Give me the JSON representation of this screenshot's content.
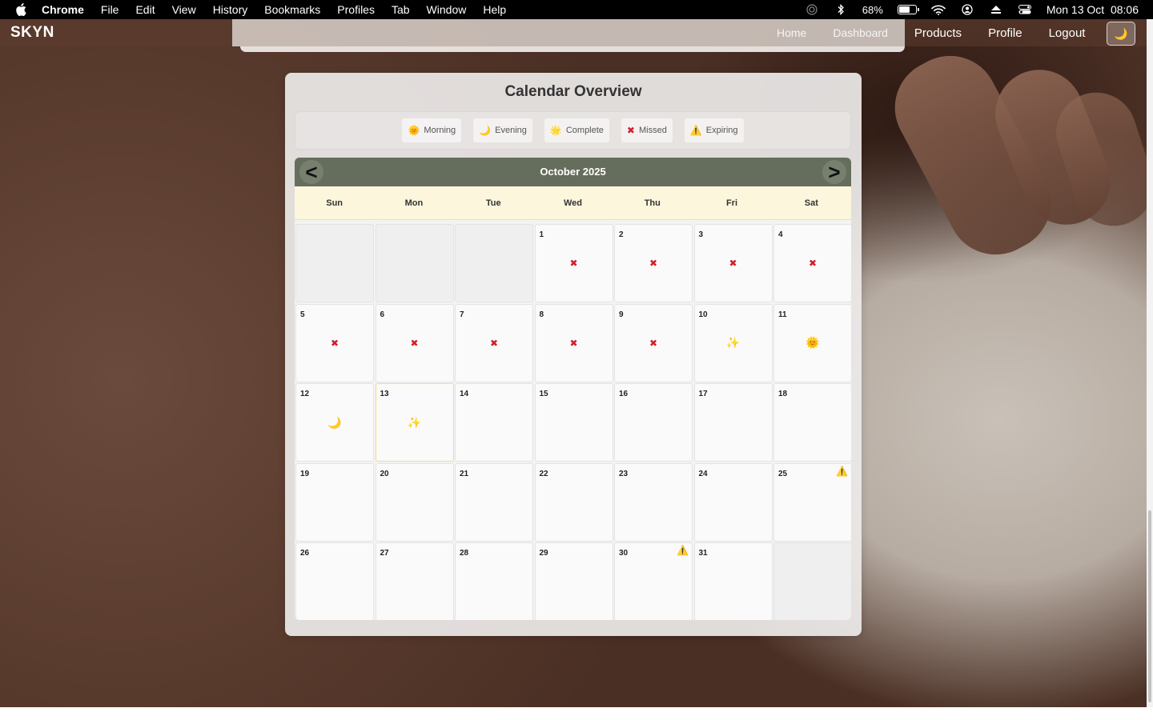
{
  "menubar": {
    "apple_icon": "apple-logo",
    "items": [
      "Chrome",
      "File",
      "Edit",
      "View",
      "History",
      "Bookmarks",
      "Profiles",
      "Tab",
      "Window",
      "Help"
    ],
    "battery": "68%",
    "datetime": "Mon 13 Oct  08:06"
  },
  "app": {
    "brand": "SKYN",
    "nav": [
      "Home",
      "Dashboard",
      "Products",
      "Profile",
      "Logout"
    ],
    "theme_toggle_icon": "🌙"
  },
  "calendar": {
    "title": "Calendar Overview",
    "legend": [
      {
        "icon": "🌞",
        "label": "Morning"
      },
      {
        "icon": "🌙",
        "label": "Evening"
      },
      {
        "icon": "🌟",
        "label": "Complete"
      },
      {
        "icon": "✖",
        "label": "Missed"
      },
      {
        "icon": "⚠️",
        "label": "Expiring"
      }
    ],
    "month_label": "October 2025",
    "prev_label": "<",
    "next_label": ">",
    "weekdays": [
      "Sun",
      "Mon",
      "Tue",
      "Wed",
      "Thu",
      "Fri",
      "Sat"
    ],
    "leading_empty": 3,
    "trailing_empty": 1,
    "today": 13,
    "days": [
      {
        "day": "1",
        "status": "missed",
        "icon": "✖"
      },
      {
        "day": "2",
        "status": "missed",
        "icon": "✖"
      },
      {
        "day": "3",
        "status": "missed",
        "icon": "✖"
      },
      {
        "day": "4",
        "status": "missed",
        "icon": "✖"
      },
      {
        "day": "5",
        "status": "missed",
        "icon": "✖"
      },
      {
        "day": "6",
        "status": "missed",
        "icon": "✖"
      },
      {
        "day": "7",
        "status": "missed",
        "icon": "✖"
      },
      {
        "day": "8",
        "status": "missed",
        "icon": "✖"
      },
      {
        "day": "9",
        "status": "missed",
        "icon": "✖"
      },
      {
        "day": "10",
        "status": "complete",
        "icon": "✨"
      },
      {
        "day": "11",
        "status": "morning",
        "icon": "🌞"
      },
      {
        "day": "12",
        "status": "evening",
        "icon": "🌙"
      },
      {
        "day": "13",
        "status": "complete",
        "icon": "✨"
      },
      {
        "day": "14",
        "status": "",
        "icon": ""
      },
      {
        "day": "15",
        "status": "",
        "icon": ""
      },
      {
        "day": "16",
        "status": "",
        "icon": ""
      },
      {
        "day": "17",
        "status": "",
        "icon": ""
      },
      {
        "day": "18",
        "status": "",
        "icon": ""
      },
      {
        "day": "19",
        "status": "",
        "icon": ""
      },
      {
        "day": "20",
        "status": "",
        "icon": ""
      },
      {
        "day": "21",
        "status": "",
        "icon": ""
      },
      {
        "day": "22",
        "status": "",
        "icon": ""
      },
      {
        "day": "23",
        "status": "",
        "icon": ""
      },
      {
        "day": "24",
        "status": "",
        "icon": ""
      },
      {
        "day": "25",
        "status": "",
        "icon": "",
        "expiring": "⚠️"
      },
      {
        "day": "26",
        "status": "",
        "icon": ""
      },
      {
        "day": "27",
        "status": "",
        "icon": ""
      },
      {
        "day": "28",
        "status": "",
        "icon": ""
      },
      {
        "day": "29",
        "status": "",
        "icon": ""
      },
      {
        "day": "30",
        "status": "",
        "icon": "",
        "expiring": "⚠️"
      },
      {
        "day": "31",
        "status": "",
        "icon": ""
      }
    ]
  }
}
